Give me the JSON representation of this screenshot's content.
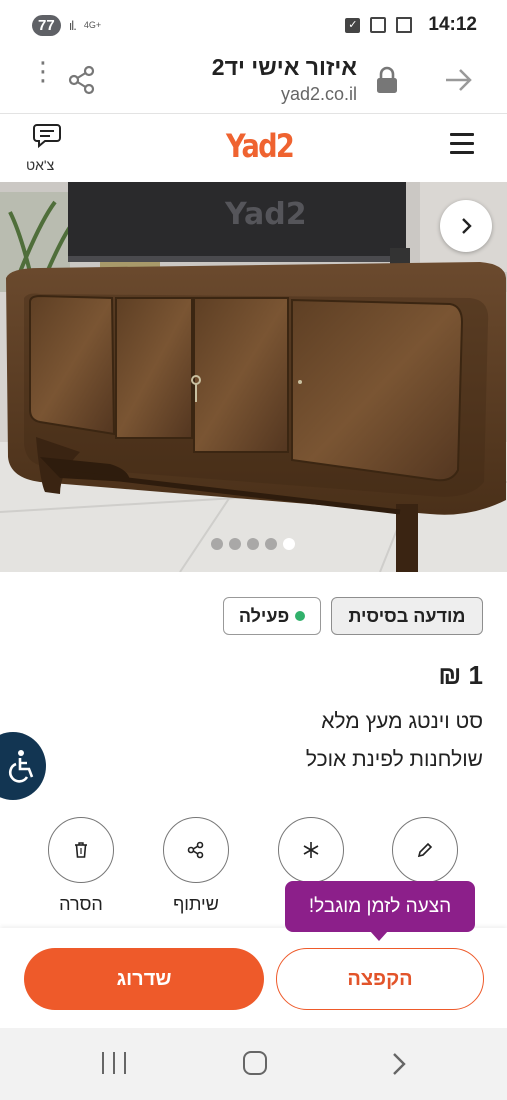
{
  "status_bar": {
    "battery": "77",
    "network": "4G+",
    "time": "14:12"
  },
  "browser": {
    "page_title": "איזור אישי יד2",
    "domain": "yad2.co.il"
  },
  "header": {
    "logo": "Yad2",
    "chat_label": "צ'אט"
  },
  "gallery": {
    "image_count": 5,
    "active_index": 4,
    "watermark": "Yad2"
  },
  "tags": {
    "basic": "מודעה בסיסית",
    "status": "פעילה",
    "status_color": "#31b16b"
  },
  "listing": {
    "price": "1 ₪",
    "title_line1": "סט וינטג מעץ מלא",
    "title_line2": "שולחנות לפינת אוכל"
  },
  "actions": {
    "edit": "",
    "freeze": "ה",
    "share": "שיתוף",
    "delete": "הסרה"
  },
  "tooltip": {
    "text": "הצעה לזמן מוגבל!"
  },
  "buttons": {
    "upgrade": "שדרוג",
    "bump": "הקפצה"
  },
  "colors": {
    "brand": "#ef6330",
    "tooltip": "#8c1f8a",
    "accessibility": "#123552"
  }
}
